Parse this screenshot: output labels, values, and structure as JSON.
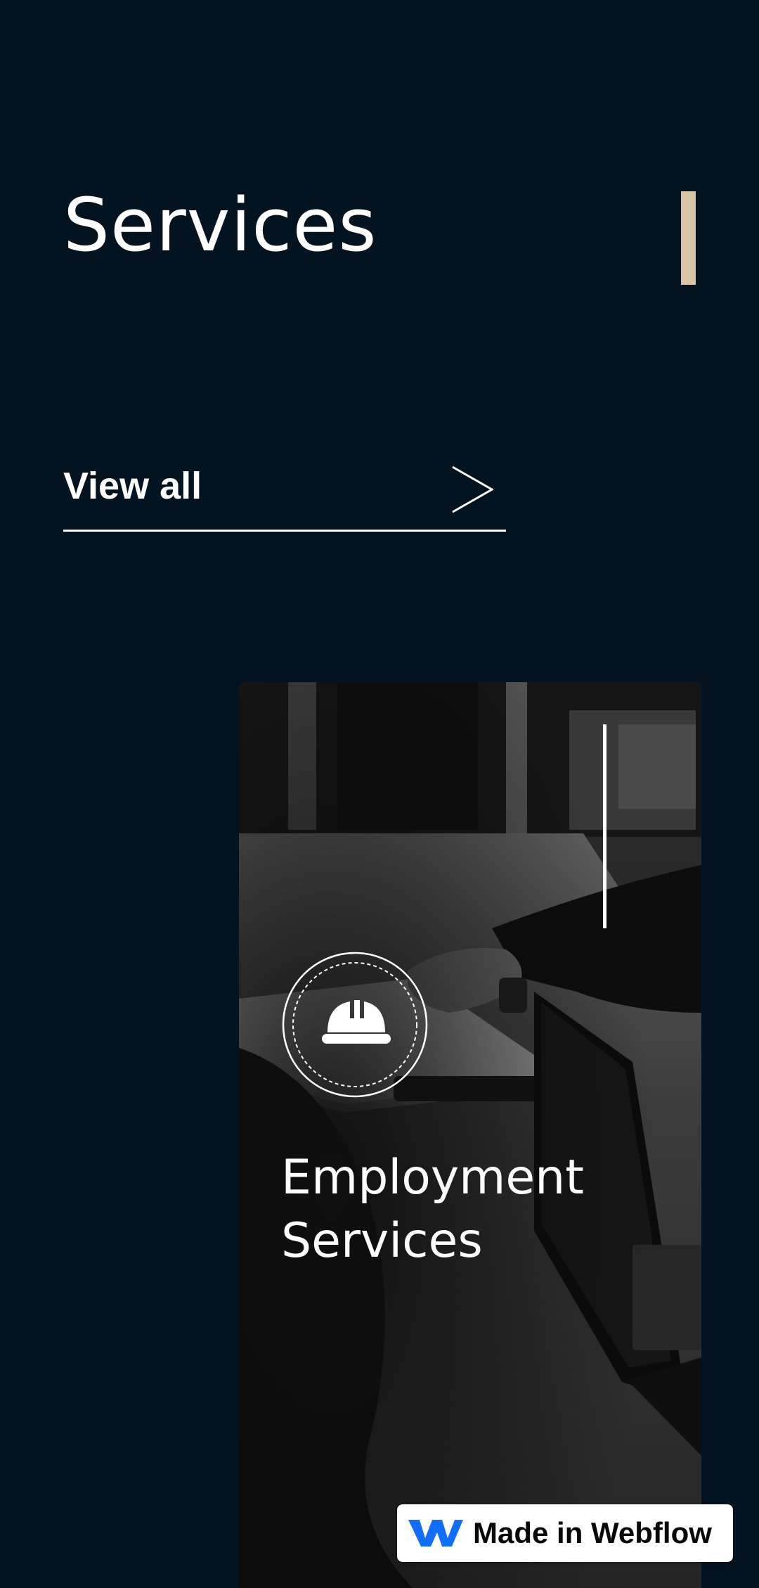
{
  "header": {
    "title": "Services"
  },
  "view_all": {
    "label": "View all",
    "icon": "arrow-right-icon"
  },
  "service_card": {
    "title": "Employment Services",
    "badge_icon": "hard-hat-icon",
    "image_description_icon": "office-photo"
  },
  "webflow_badge": {
    "label": "Made in Webflow",
    "icon": "webflow-logo-icon"
  },
  "colors": {
    "background": "#041320",
    "accent": "#d9c4a6",
    "text": "#ffffff",
    "webflow_brand": "#146ef5"
  }
}
